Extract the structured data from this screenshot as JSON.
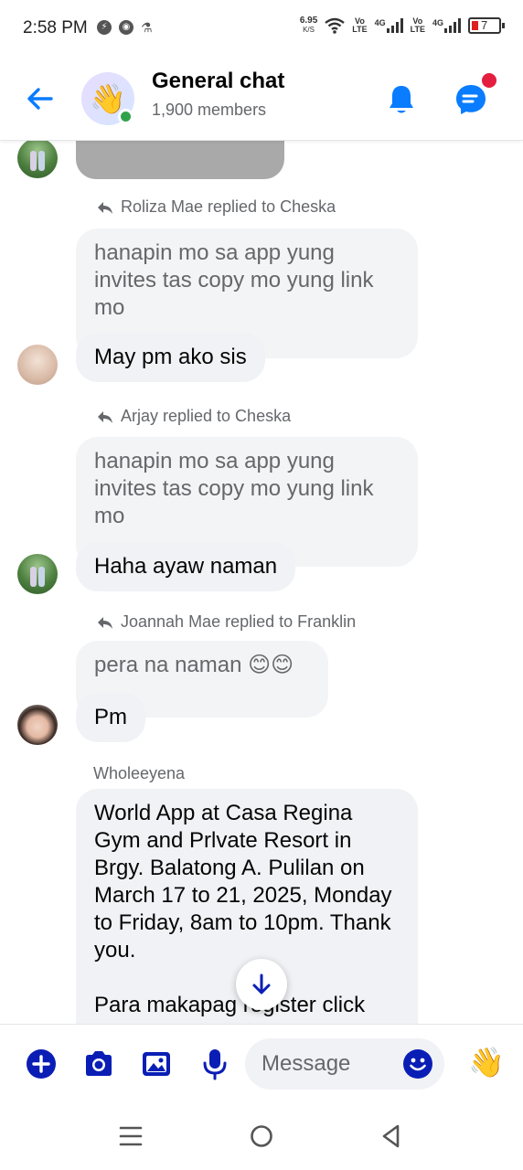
{
  "status_bar": {
    "time": "2:58 PM",
    "speed_value": "6.95",
    "speed_unit": "K/S",
    "volte1": "Vo\nLTE",
    "net1": "4G",
    "volte2": "Vo\nLTE",
    "net2": "4G",
    "battery": "7"
  },
  "header": {
    "title": "General chat",
    "subtitle": "1,900 members",
    "avatar_emoji": "👋"
  },
  "messages": [
    {
      "reply_label": "Roliza Mae replied to Cheska",
      "quoted": "hanapin mo sa app yung invites tas copy mo yung link mo",
      "text": "May pm ako sis"
    },
    {
      "reply_label": "Arjay replied to Cheska",
      "quoted": "hanapin mo sa app yung invites tas copy mo yung link mo",
      "text": "Haha ayaw naman"
    },
    {
      "reply_label": "Joannah Mae replied to Franklin",
      "quoted": "pera na naman 😊😊",
      "text": "Pm"
    },
    {
      "sender": "Wholeeyena",
      "text": "World App at Casa Regina Gym and Prlvate Resort in Brgy. Balatong A. Pulilan on March 17 to 21, 2025, Monday to Friday, 8am to 10pm. Thank you.\n\nPara makapag register click"
    }
  ],
  "composer": {
    "placeholder": "Message",
    "wave_emoji": "👋"
  },
  "colors": {
    "accent": "#0a7cff",
    "composer_icons": "#0a1eb5",
    "bubble": "#f0f2f5",
    "badge_red": "#e41e3f",
    "online_green": "#31a24c"
  },
  "icons": {
    "back": "arrow-left-icon",
    "bell": "bell-icon",
    "threads": "chat-threads-icon",
    "add": "plus-circle-icon",
    "camera": "camera-icon",
    "gallery": "image-icon",
    "mic": "microphone-icon",
    "emoji": "smiley-icon",
    "scroll": "arrow-down-icon"
  }
}
